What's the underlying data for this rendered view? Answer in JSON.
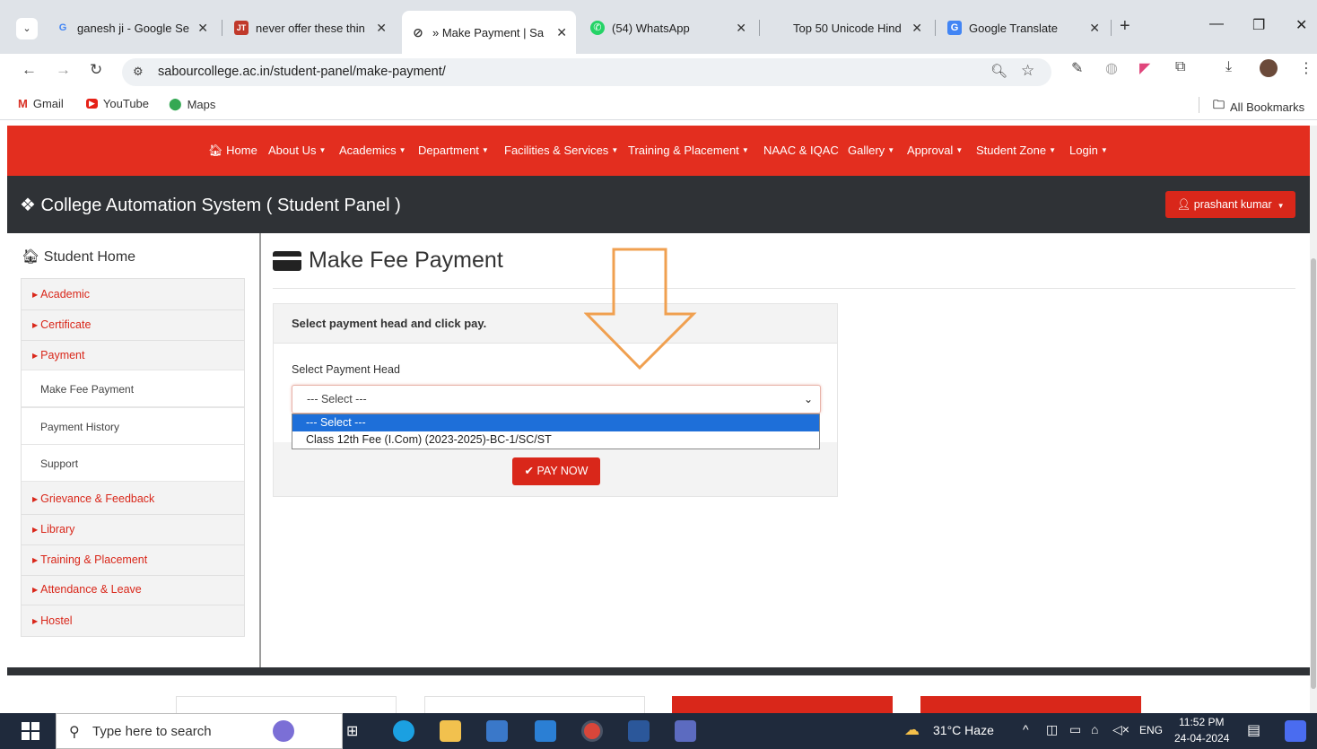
{
  "browser": {
    "tabs": [
      {
        "title": "ganesh ji - Google Se",
        "icon": "google-g-icon",
        "active": false
      },
      {
        "title": "never offer these thin",
        "icon": "jt-icon",
        "active": false
      },
      {
        "title": "» Make Payment | Sa",
        "icon": "globe-icon",
        "active": true
      },
      {
        "title": "(54) WhatsApp",
        "icon": "whatsapp-icon",
        "active": false
      },
      {
        "title": "Top 50 Unicode Hind",
        "icon": "blank-icon",
        "active": false
      },
      {
        "title": "Google Translate",
        "icon": "translate-icon",
        "active": false
      }
    ],
    "url": "sabourcollege.ac.in/student-panel/make-payment/",
    "bookmarks": [
      "Gmail",
      "YouTube",
      "Maps"
    ],
    "all_bookmarks": "All Bookmarks"
  },
  "site": {
    "nav": [
      {
        "label": "Home",
        "caret": false
      },
      {
        "label": "About Us",
        "caret": true
      },
      {
        "label": "Academics",
        "caret": true
      },
      {
        "label": "Department",
        "caret": true
      },
      {
        "label": "Facilities & Services",
        "caret": true
      },
      {
        "label": "Training & Placement",
        "caret": true
      },
      {
        "label": "NAAC & IQAC",
        "caret": false
      },
      {
        "label": "Gallery",
        "caret": true
      },
      {
        "label": "Approval",
        "caret": true
      },
      {
        "label": "Student Zone",
        "caret": true
      },
      {
        "label": "Login",
        "caret": true
      }
    ],
    "brand": "College Automation System ( Student Panel )",
    "user": "prashant kumar"
  },
  "sidebar": {
    "home": "Student Home",
    "items": [
      {
        "label": "Academic",
        "type": "section"
      },
      {
        "label": "Certificate",
        "type": "section"
      },
      {
        "label": "Payment",
        "type": "section"
      },
      {
        "label": "Make Fee Payment",
        "type": "sub"
      },
      {
        "label": "Payment History",
        "type": "sub"
      },
      {
        "label": "Support",
        "type": "sub"
      },
      {
        "label": "Grievance & Feedback",
        "type": "section"
      },
      {
        "label": "Library",
        "type": "section"
      },
      {
        "label": "Training & Placement",
        "type": "section"
      },
      {
        "label": "Attendance & Leave",
        "type": "section"
      },
      {
        "label": "Hostel",
        "type": "section"
      }
    ]
  },
  "main": {
    "title": "Make Fee Payment",
    "panel_heading": "Select payment head and click pay.",
    "field_label": "Select Payment Head",
    "select_value": "--- Select ---",
    "options": [
      "--- Select ---",
      "Class 12th Fee (I.Com) (2023-2025)-BC-1/SC/ST"
    ],
    "pay_button": "PAY NOW"
  },
  "taskbar": {
    "search_placeholder": "Type here to search",
    "weather": "31°C  Haze",
    "language": "ENG",
    "time": "11:52 PM",
    "date": "24-04-2024"
  },
  "colors": {
    "brand_red": "#e32e1f",
    "dark_header": "#2f3236",
    "arrow_orange": "#f0a050"
  }
}
